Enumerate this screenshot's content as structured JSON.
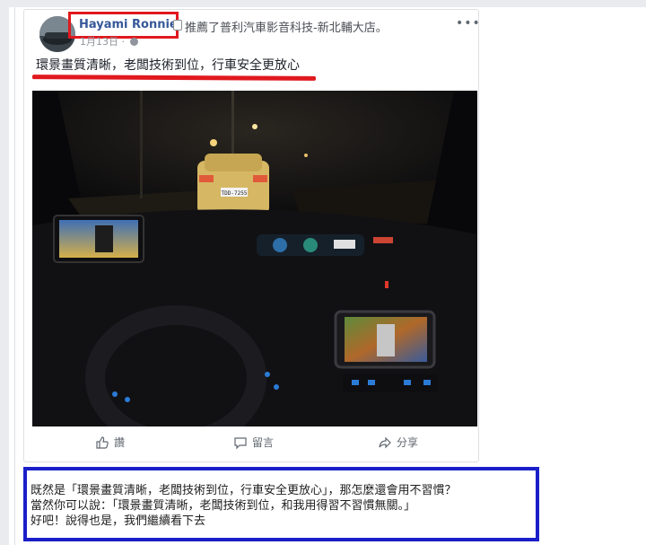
{
  "post": {
    "author": "Hayami Ronnie",
    "recommendation": "推薦了普利汽車影音科技-新北輔大店。",
    "date": "1月13日 ·",
    "more_label": "•••",
    "text": "環景畫質清晰，老闆技術到位，行車安全更放心"
  },
  "photo": {
    "plate": "TDD-7255"
  },
  "actions": {
    "like": "讚",
    "comment": "留言",
    "share": "分享"
  },
  "commentary": {
    "line1": "既然是「環景畫質清晰，老闆技術到位，行車安全更放心」，那怎麼還會用不習慣？",
    "line2": "當然你可以說：「環景畫質清晰，老闆技術到位，和我用得習不習慣無關。」",
    "line3": "好吧！說得也是，我們繼續看下去"
  },
  "colors": {
    "link": "#365899",
    "annotation_red": "#e0191f",
    "annotation_blue": "#1b1fc9"
  }
}
